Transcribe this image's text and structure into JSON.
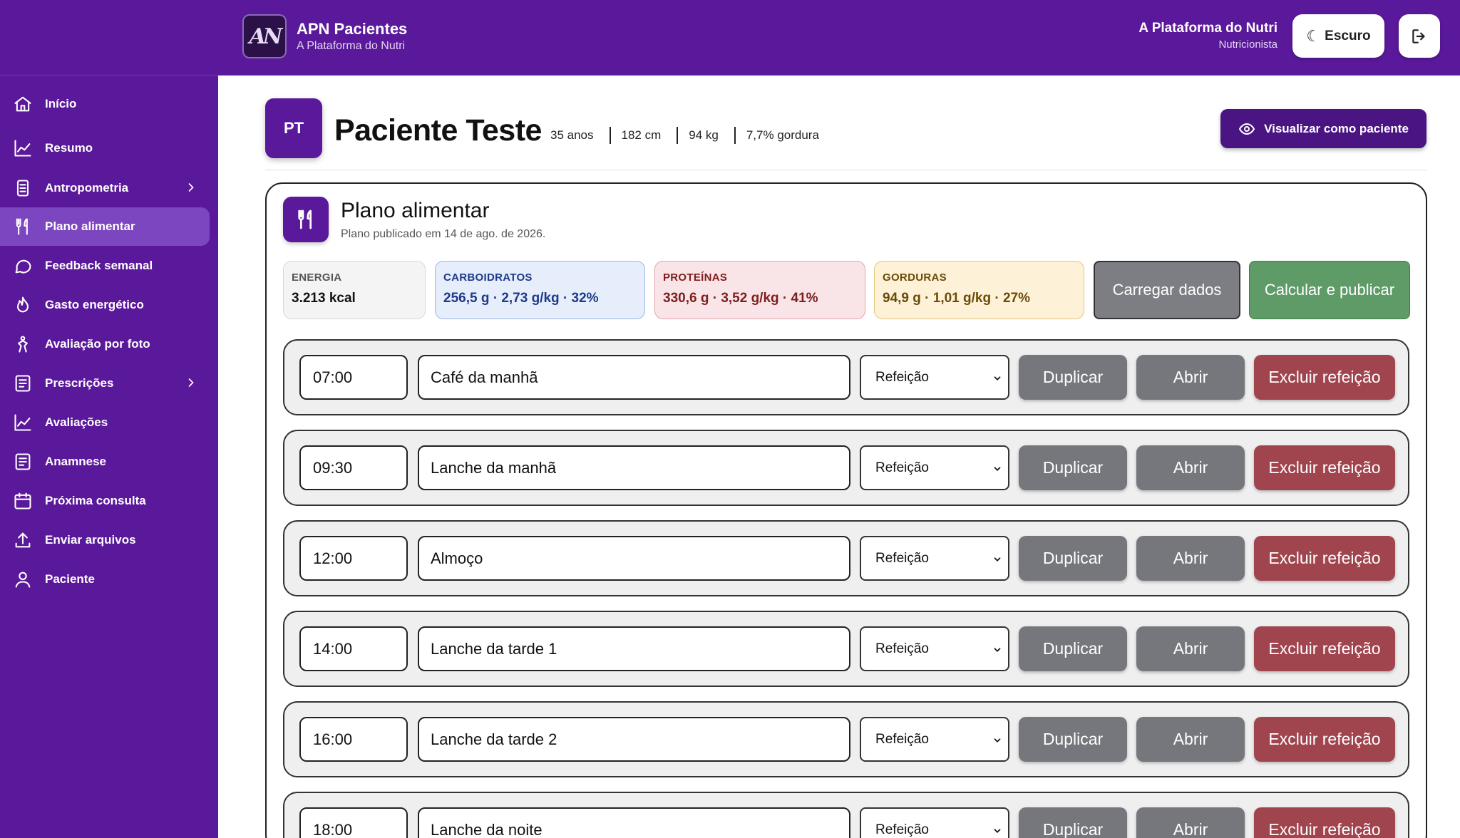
{
  "app": {
    "title": "APN Pacientes",
    "subtitle": "A Plataforma do Nutri",
    "logo_text": "AN"
  },
  "user": {
    "name": "A Plataforma do Nutri",
    "role": "Nutricionista"
  },
  "header": {
    "theme_label": "Escuro"
  },
  "sidebar": {
    "items": [
      {
        "label": "Início",
        "icon": "home-icon"
      },
      {
        "label": "Resumo",
        "icon": "chart-icon"
      },
      {
        "label": "Antropometria",
        "icon": "document-icon",
        "chevron": true
      },
      {
        "label": "Plano alimentar",
        "icon": "fork-knife-icon",
        "active": true
      },
      {
        "label": "Feedback semanal",
        "icon": "chat-icon"
      },
      {
        "label": "Gasto energético",
        "icon": "flame-icon"
      },
      {
        "label": "Avaliação por foto",
        "icon": "person-icon"
      },
      {
        "label": "Prescrições",
        "icon": "list-icon",
        "chevron": true
      },
      {
        "label": "Avaliações",
        "icon": "chart-icon"
      },
      {
        "label": "Anamnese",
        "icon": "list-icon"
      },
      {
        "label": "Próxima consulta",
        "icon": "calendar-icon"
      },
      {
        "label": "Enviar arquivos",
        "icon": "upload-icon"
      },
      {
        "label": "Paciente",
        "icon": "user-icon"
      }
    ]
  },
  "patient": {
    "initials": "PT",
    "name": "Paciente Teste",
    "age": "35 anos",
    "height": "182 cm",
    "weight": "94 kg",
    "fat": "7,7% gordura",
    "view_as_patient": "Visualizar como paciente"
  },
  "plan": {
    "title": "Plano alimentar",
    "subtitle": "Plano publicado em 14 de ago. de 2026.",
    "macros": {
      "energia": {
        "label": "ENERGIA",
        "value": "3.213 kcal"
      },
      "carb": {
        "label": "CARBOIDRATOS",
        "value": "256,5 g · 2,73 g/kg · 32%"
      },
      "prot": {
        "label": "PROTEÍNAS",
        "value": "330,6 g · 3,52 g/kg · 41%"
      },
      "gord": {
        "label": "GORDURAS",
        "value": "94,9 g · 1,01 g/kg · 27%"
      }
    },
    "load_label": "Carregar dados",
    "calc_label": "Calcular e publicar",
    "buttons": {
      "duplicate": "Duplicar",
      "open": "Abrir",
      "delete": "Excluir refeição"
    },
    "meals": [
      {
        "time": "07:00",
        "name": "Café da manhã",
        "type": "Refeição"
      },
      {
        "time": "09:30",
        "name": "Lanche da manhã",
        "type": "Refeição"
      },
      {
        "time": "12:00",
        "name": "Almoço",
        "type": "Refeição"
      },
      {
        "time": "14:00",
        "name": "Lanche da tarde 1",
        "type": "Refeição"
      },
      {
        "time": "16:00",
        "name": "Lanche da tarde 2",
        "type": "Refeição"
      },
      {
        "time": "18:00",
        "name": "Lanche da noite",
        "type": "Refeição"
      }
    ]
  }
}
